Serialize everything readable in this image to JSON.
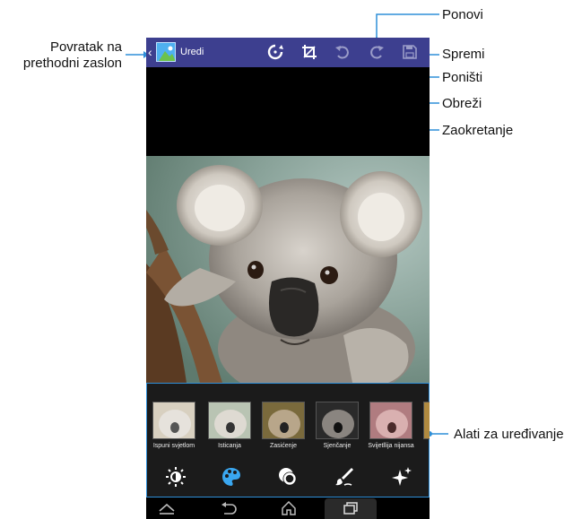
{
  "app_bar": {
    "back_glyph": "‹",
    "title": "Uredi",
    "icons": [
      "rotate-icon",
      "crop-icon",
      "undo-icon",
      "redo-icon",
      "save-icon"
    ]
  },
  "callouts": {
    "back": "Povratak na\nprethodni zaslon",
    "redo": "Ponovi",
    "save": "Spremi",
    "undo": "Poništi",
    "crop": "Obreži",
    "rotate": "Zaokretanje",
    "tools": "Alati za uređivanje"
  },
  "effects": [
    {
      "label": "Ispuni svjetlom",
      "tint": "#d8d0c0"
    },
    {
      "label": "Isticanja",
      "tint": "#c9c6b8"
    },
    {
      "label": "Zasićenje",
      "tint": "#9a7b45"
    },
    {
      "label": "Sjenčanje",
      "tint": "#6b6b6b"
    },
    {
      "label": "Svijetllija nijansa",
      "tint": "#c8a0a0"
    },
    {
      "label": "",
      "tint": "#b08a40"
    }
  ],
  "tool_icons": [
    "brightness-icon",
    "palette-icon",
    "circles-icon",
    "brush-icon",
    "sparkle-icon"
  ],
  "nav_icons": [
    "home-up-icon",
    "back-icon",
    "home-icon",
    "recent-apps-icon"
  ],
  "colors": {
    "action_bar": "#3d3f8f",
    "accent": "#2f8fd8",
    "callout_line": "#2f8fd8"
  }
}
